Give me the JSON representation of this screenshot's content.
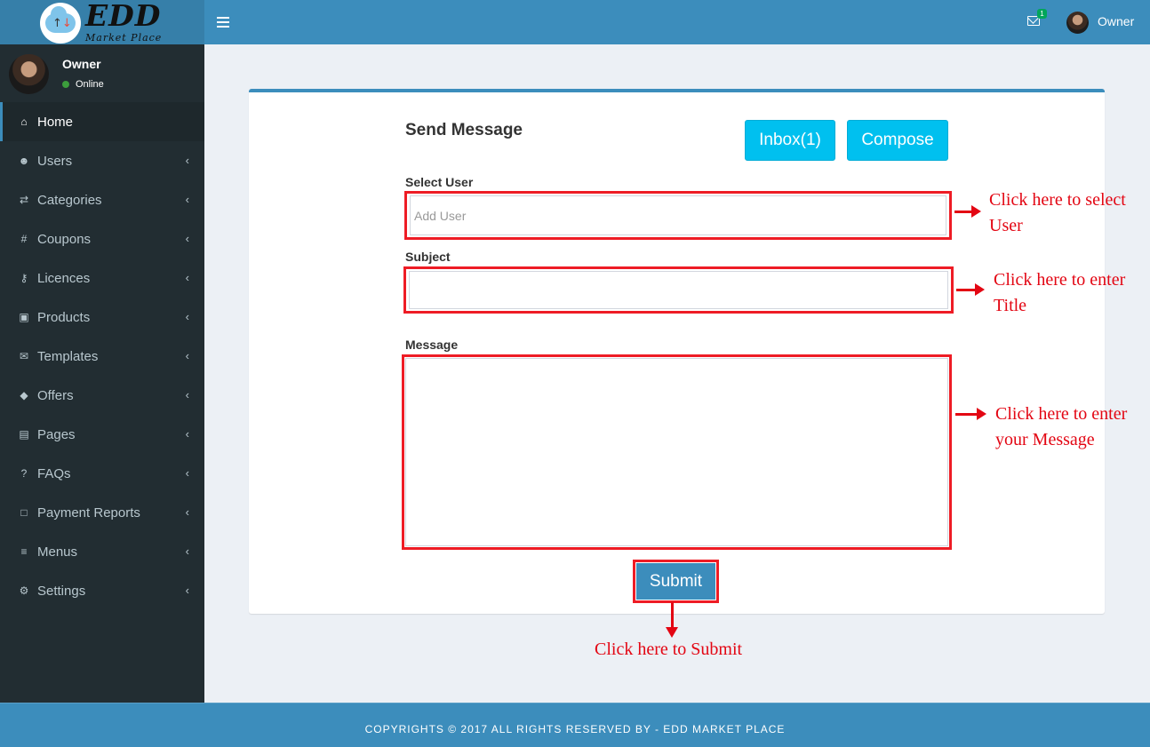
{
  "brand": {
    "name": "EDD",
    "tagline": "Market Place"
  },
  "header": {
    "mail_badge": "1",
    "user_name": "Owner"
  },
  "user_panel": {
    "name": "Owner",
    "status": "Online"
  },
  "sidebar": {
    "items": [
      {
        "label": "Home",
        "icon": "home-icon",
        "glyph": "⌂",
        "active": true
      },
      {
        "label": "Users",
        "icon": "users-icon",
        "glyph": "☻"
      },
      {
        "label": "Categories",
        "icon": "random-icon",
        "glyph": "⇄"
      },
      {
        "label": "Coupons",
        "icon": "hashtag-icon",
        "glyph": "#"
      },
      {
        "label": "Licences",
        "icon": "key-icon",
        "glyph": "⚷"
      },
      {
        "label": "Products",
        "icon": "shopping-bag-icon",
        "glyph": "▣"
      },
      {
        "label": "Templates",
        "icon": "comment-icon",
        "glyph": "✉"
      },
      {
        "label": "Offers",
        "icon": "tags-icon",
        "glyph": "◆"
      },
      {
        "label": "Pages",
        "icon": "file-icon",
        "glyph": "▤"
      },
      {
        "label": "FAQs",
        "icon": "question-icon",
        "glyph": "?"
      },
      {
        "label": "Payment Reports",
        "icon": "file-o-icon",
        "glyph": "□"
      },
      {
        "label": "Menus",
        "icon": "bars-icon",
        "glyph": "≡"
      },
      {
        "label": "Settings",
        "icon": "gear-icon",
        "glyph": "⚙"
      }
    ]
  },
  "form": {
    "title": "Send Message",
    "inbox_label": "Inbox(1)",
    "compose_label": "Compose",
    "select_user_label": "Select User",
    "select_user_placeholder": "Add User",
    "subject_label": "Subject",
    "subject_value": "",
    "message_label": "Message",
    "message_value": "",
    "submit_label": "Submit"
  },
  "annotations": {
    "select_user": [
      "Click here to select",
      "User"
    ],
    "subject": [
      "Click here to enter",
      "Title"
    ],
    "message": [
      "Click here to enter",
      "your Message"
    ],
    "submit": "Click here to Submit"
  },
  "footer": {
    "text": "COPYRIGHTS © 2017 ALL RIGHTS RESERVED BY - EDD MARKET PLACE"
  },
  "colors": {
    "primary": "#3c8dbc",
    "sidebar": "#222d32",
    "info": "#00c0ef",
    "annotation": "#e30613"
  }
}
